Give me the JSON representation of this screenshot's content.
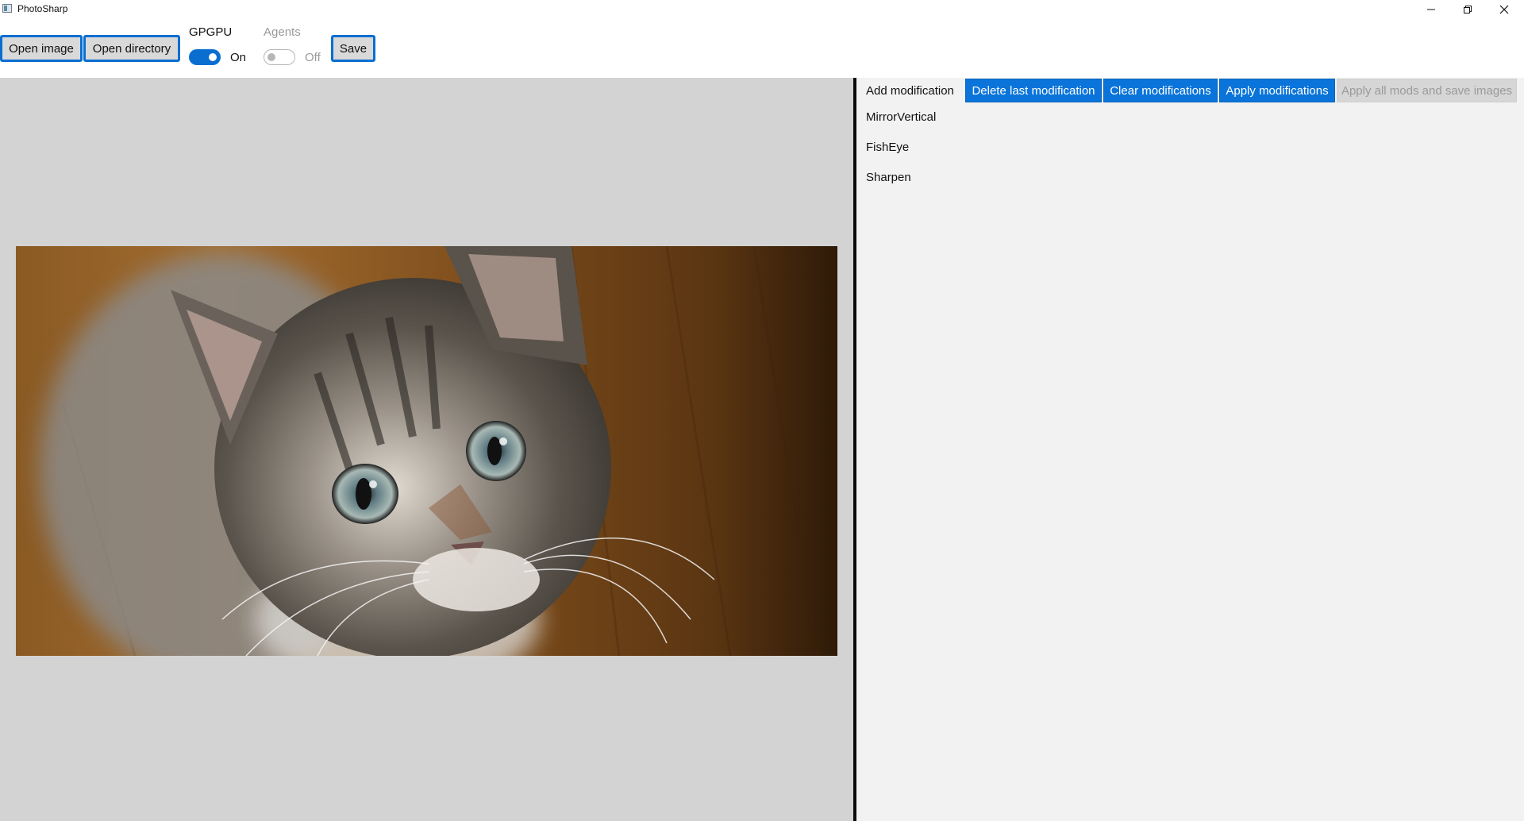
{
  "window": {
    "title": "PhotoSharp"
  },
  "toolbar": {
    "open_image_label": "Open image",
    "open_directory_label": "Open directory",
    "save_label": "Save",
    "gpgpu": {
      "label": "GPGPU",
      "state_text": "On",
      "enabled": true
    },
    "agents": {
      "label": "Agents",
      "state_text": "Off",
      "enabled": false
    }
  },
  "side_panel": {
    "add_modification_label": "Add modification",
    "actions": [
      {
        "label": "Delete last modification",
        "enabled": true
      },
      {
        "label": "Clear modifications",
        "enabled": true
      },
      {
        "label": "Apply modifications",
        "enabled": true
      },
      {
        "label": "Apply all mods and save images",
        "enabled": false
      }
    ],
    "modifications": [
      "MirrorVertical",
      "FishEye",
      "Sharpen"
    ]
  },
  "colors": {
    "accent": "#0a74da",
    "canvas_bg": "#d3d3d3",
    "panel_bg": "#f2f2f2"
  }
}
